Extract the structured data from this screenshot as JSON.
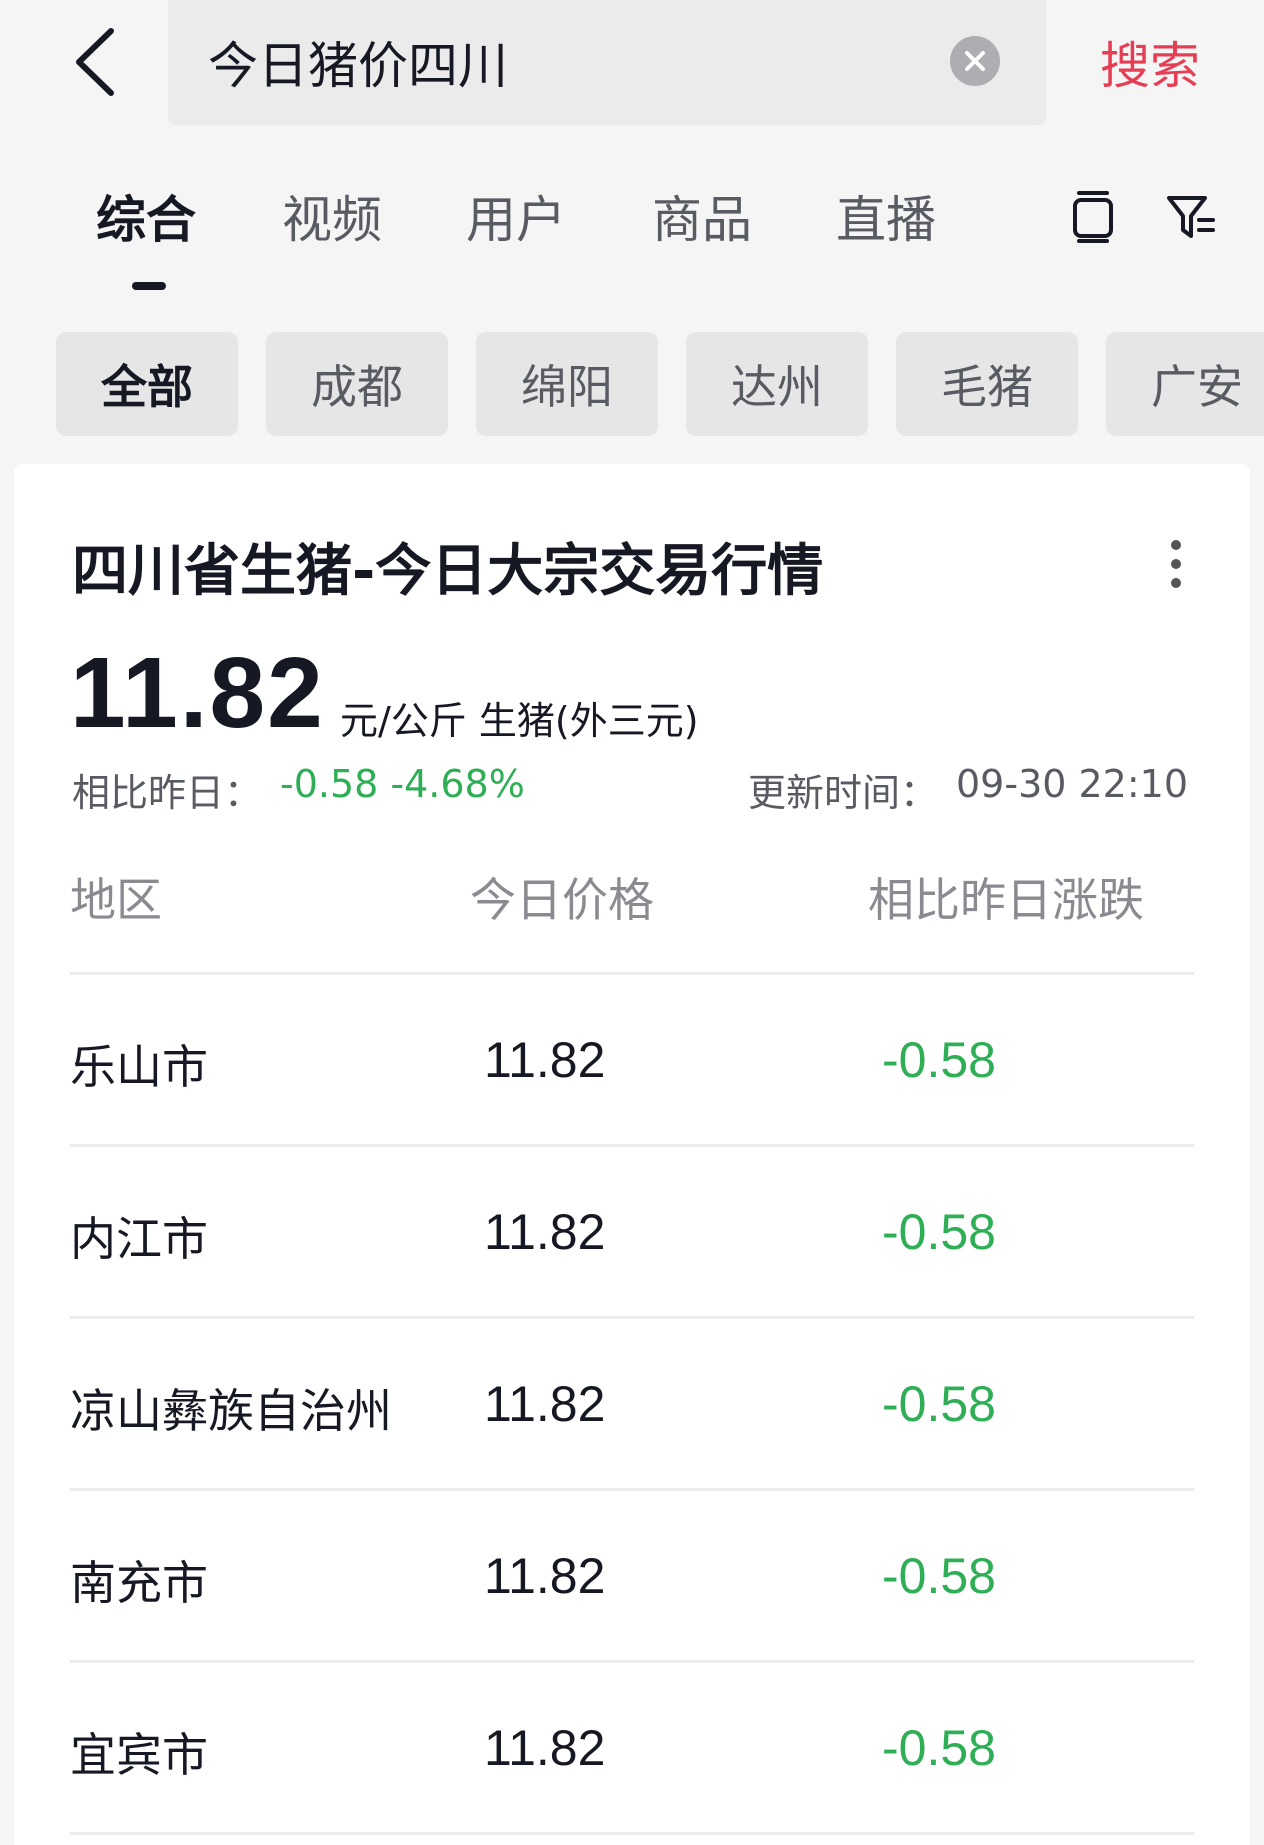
{
  "search": {
    "query": "今日猪价四川",
    "button_label": "搜索"
  },
  "tabs": [
    {
      "label": "综合",
      "active": true
    },
    {
      "label": "视频"
    },
    {
      "label": "用户"
    },
    {
      "label": "商品"
    },
    {
      "label": "直播"
    }
  ],
  "chips": [
    {
      "label": "全部",
      "active": true
    },
    {
      "label": "成都"
    },
    {
      "label": "绵阳"
    },
    {
      "label": "达州"
    },
    {
      "label": "毛猪"
    },
    {
      "label": "广安"
    }
  ],
  "card": {
    "title": "四川省生猪-今日大宗交易行情",
    "price": "11.82",
    "unit": "元/公斤 生猪(外三元)",
    "compare_label": "相比昨日：",
    "compare_value": "-0.58 -4.68%",
    "update_label": "更新时间：",
    "update_value": "09-30 22:10",
    "table": {
      "headers": [
        "地区",
        "今日价格",
        "相比昨日涨跌"
      ],
      "rows": [
        {
          "region": "乐山市",
          "price": "11.82",
          "change": "-0.58"
        },
        {
          "region": "内江市",
          "price": "11.82",
          "change": "-0.58"
        },
        {
          "region": "凉山彝族自治州",
          "price": "11.82",
          "change": "-0.58"
        },
        {
          "region": "南充市",
          "price": "11.82",
          "change": "-0.58"
        },
        {
          "region": "宜宾市",
          "price": "11.82",
          "change": "-0.58"
        }
      ]
    }
  },
  "colors": {
    "accent": "#e53e54",
    "down": "#2eae55"
  }
}
